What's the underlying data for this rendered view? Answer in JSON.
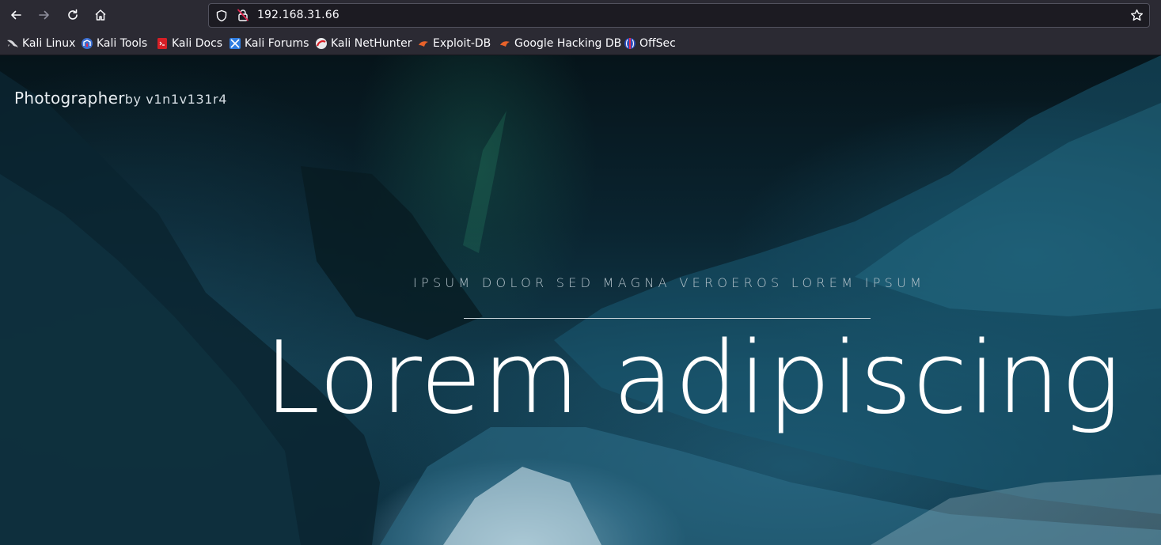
{
  "browser": {
    "url": "192.168.31.66",
    "bookmarks": [
      {
        "label": "Kali Linux",
        "icon": "kali-dragon-icon"
      },
      {
        "label": "Kali Tools",
        "icon": "kali-tools-icon"
      },
      {
        "label": "Kali Docs",
        "icon": "kali-docs-icon"
      },
      {
        "label": "Kali Forums",
        "icon": "kali-forums-icon"
      },
      {
        "label": "Kali NetHunter",
        "icon": "kali-nethunter-icon"
      },
      {
        "label": "Exploit-DB",
        "icon": "exploit-db-icon"
      },
      {
        "label": "Google Hacking DB",
        "icon": "google-hacking-db-icon"
      },
      {
        "label": "OffSec",
        "icon": "offsec-icon"
      }
    ]
  },
  "site": {
    "brand": "Photographer",
    "brand_by": "by v1n1v131r4",
    "tagline": "IPSUM DOLOR SED MAGNA VEROEROS LOREM IPSUM",
    "headline": "Lorem adipiscing"
  },
  "colors": {
    "chrome_bg": "#2b2a33",
    "urlbar_bg": "#1c1b22",
    "lock_warning": "#e22850"
  }
}
